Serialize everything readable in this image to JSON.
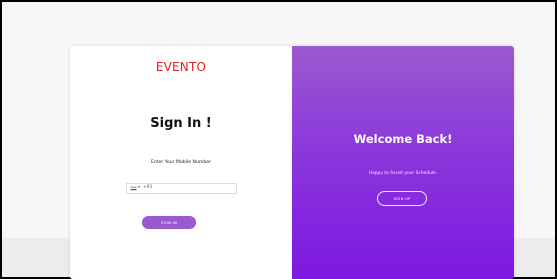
{
  "colors": {
    "brand_red": "#e31d1d",
    "purple_start": "#9b59cf",
    "purple_end": "#7d18e1",
    "button_purple": "#9b59d0"
  },
  "left_panel": {
    "logo": "EVENTO",
    "title": "Sign In !",
    "mobile_label": "Enter Your Mobile Number",
    "country_code": "+91",
    "signin_button": "SIGN IN"
  },
  "right_panel": {
    "title": "Welcome Back!",
    "subtitle": "Happy to Assist your Schedule.",
    "signup_button": "SIGN UP"
  },
  "icons": {
    "flag": "india-flag-icon",
    "dropdown": "chevron-down-icon"
  }
}
